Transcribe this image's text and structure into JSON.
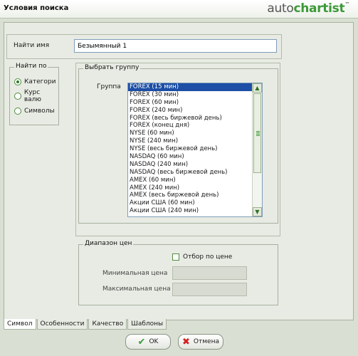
{
  "window": {
    "title": "Условия поиска"
  },
  "brand": {
    "prefix": "auto",
    "accent": "chartist",
    "tm": "™"
  },
  "find_name": {
    "label": "Найти имя",
    "value": "Безымянный 1"
  },
  "find_by": {
    "legend": "Найти по",
    "options": [
      "Категори",
      "Курс валю",
      "Символы"
    ],
    "selected": 0
  },
  "group_box": {
    "legend": "Выбрать группу",
    "group_label": "Группа",
    "items": [
      "FOREX (15 мин)",
      "FOREX (30 мин)",
      "FOREX (60 мин)",
      "FOREX (240 мин)",
      "FOREX (весь биржевой день)",
      "FOREX (конец дня)",
      "NYSE (60 мин)",
      "NYSE (240 мин)",
      "NYSE (весь биржевой день)",
      "NASDAQ (60 мин)",
      "NASDAQ (240 мин)",
      "NASDAQ (весь биржевой день)",
      "AMEX (60 мин)",
      "AMEX (240 мин)",
      "AMEX (весь биржевой день)",
      "Акции США (60 мин)",
      "Акции США (240 мин)"
    ],
    "selected": 0
  },
  "price_range": {
    "legend": "Диапазон цен",
    "filter_label": "Отбор по цене",
    "min_label": "Минимальная цена",
    "max_label": "Максимальная цена"
  },
  "tabs": [
    "Символ",
    "Особенности",
    "Качество",
    "Шаблоны"
  ],
  "active_tab": 0,
  "buttons": {
    "ok": "OK",
    "cancel": "Отмена"
  },
  "colors": {
    "accent": "#3c9a38",
    "selection": "#1c4fa5",
    "cancel": "#d32020"
  }
}
